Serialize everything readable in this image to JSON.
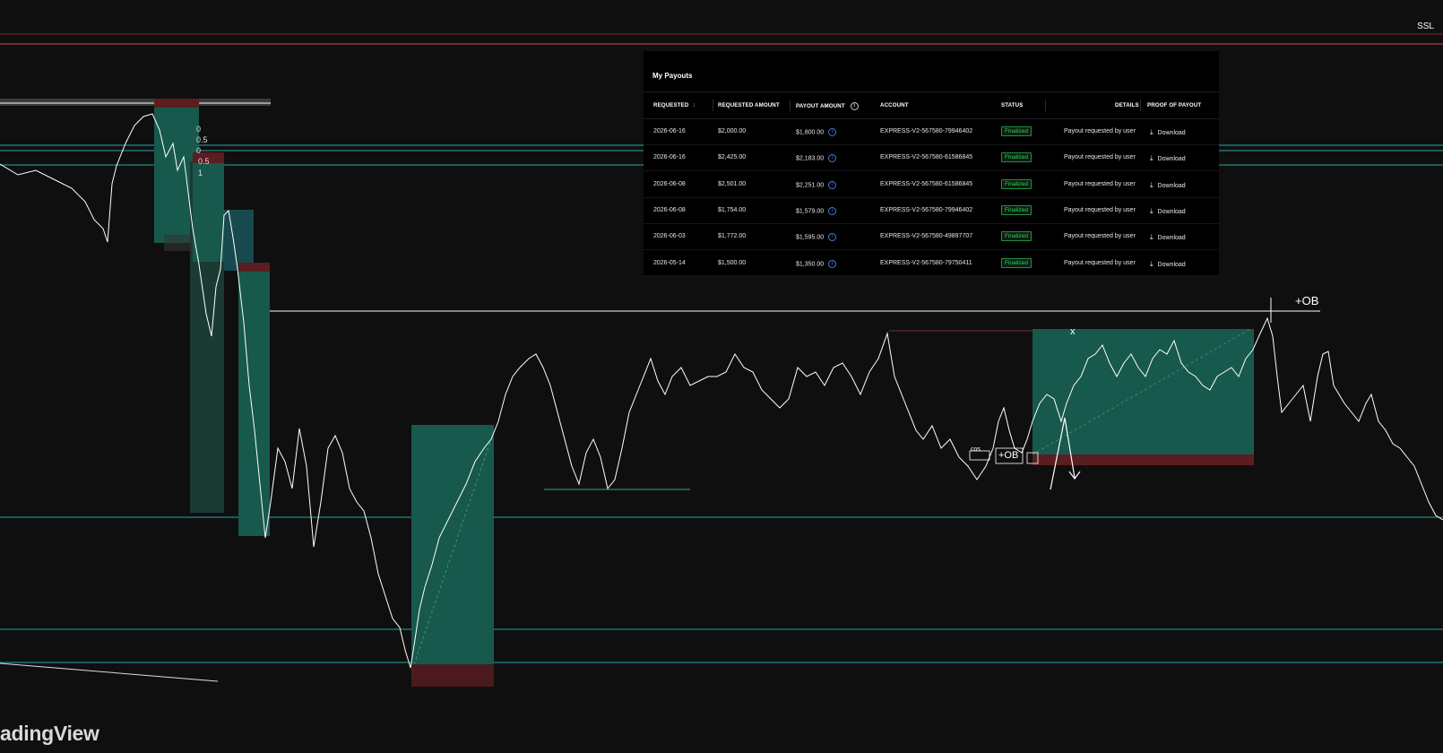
{
  "chart_labels": {
    "ssl": "SSL",
    "plus_ob": "+OB",
    "cos": "cos",
    "ob": "+OB",
    "x_mark": "x",
    "fib_levels": [
      "0",
      "0.5",
      "0",
      "0.5",
      "1"
    ],
    "watermark": "adingView"
  },
  "colors": {
    "background": "#0f0f10",
    "teal_zone": "#17594c",
    "red_zone": "#5a1d20",
    "teal_line": "#2aa6a0",
    "red_line": "#7a2b2e",
    "price_line": "#ffffff",
    "finalized_green": "#33d05d",
    "info_blue": "#4b7bd9"
  },
  "payouts": {
    "title": "My Payouts",
    "columns": [
      {
        "key": "requested",
        "label": "REQUESTED",
        "icon": "sort-arrow-down-icon"
      },
      {
        "key": "requested_amount",
        "label": "REQUESTED AMOUNT"
      },
      {
        "key": "payout_amount",
        "label": "PAYOUT AMOUNT",
        "icon": "info-icon"
      },
      {
        "key": "account",
        "label": "ACCOUNT"
      },
      {
        "key": "status",
        "label": "STATUS"
      },
      {
        "key": "details",
        "label": "DETAILS"
      },
      {
        "key": "proof",
        "label": "PROOF OF PAYOUT"
      }
    ],
    "rows": [
      {
        "requested": "2026-06-16",
        "requested_amount": "$2,000.00",
        "payout_amount": "$1,800.00",
        "account": "EXPRESS-V2-567580-79946402",
        "status": "Finalized",
        "details": "Payout requested by user",
        "proof": "Download"
      },
      {
        "requested": "2026-06-16",
        "requested_amount": "$2,425.00",
        "payout_amount": "$2,183.00",
        "account": "EXPRESS-V2-567580-61586845",
        "status": "Finalized",
        "details": "Payout requested by user",
        "proof": "Download"
      },
      {
        "requested": "2026-06-08",
        "requested_amount": "$2,501.00",
        "payout_amount": "$2,251.00",
        "account": "EXPRESS-V2-567580-61586845",
        "status": "Finalized",
        "details": "Payout requested by user",
        "proof": "Download"
      },
      {
        "requested": "2026-06-08",
        "requested_amount": "$1,754.00",
        "payout_amount": "$1,579.00",
        "account": "EXPRESS-V2-567580-79946402",
        "status": "Finalized",
        "details": "Payout requested by user",
        "proof": "Download"
      },
      {
        "requested": "2026-06-03",
        "requested_amount": "$1,772.00",
        "payout_amount": "$1,595.00",
        "account": "EXPRESS-V2-567580-49897707",
        "status": "Finalized",
        "details": "Payout requested by user",
        "proof": "Download"
      },
      {
        "requested": "2026-05-14",
        "requested_amount": "$1,500.00",
        "payout_amount": "$1,350.00",
        "account": "EXPRESS-V2-567580-79750411",
        "status": "Finalized",
        "details": "Payout requested by user",
        "proof": "Download"
      }
    ]
  }
}
